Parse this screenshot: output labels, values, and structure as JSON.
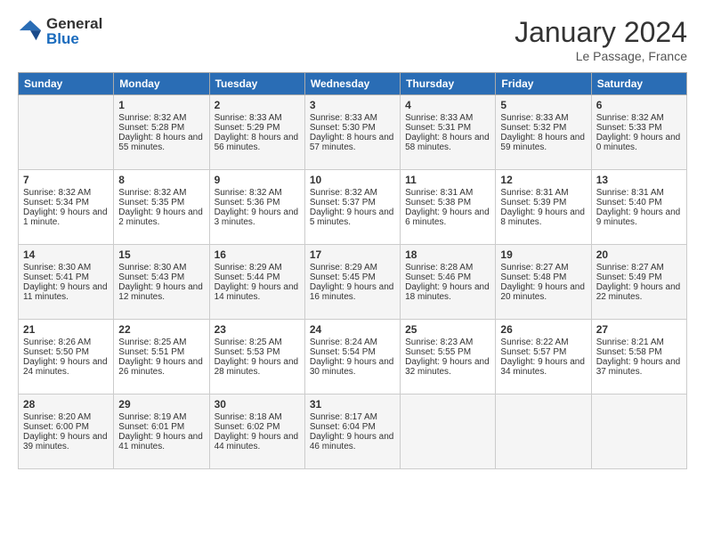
{
  "logo": {
    "general": "General",
    "blue": "Blue"
  },
  "title": "January 2024",
  "subtitle": "Le Passage, France",
  "days_header": [
    "Sunday",
    "Monday",
    "Tuesday",
    "Wednesday",
    "Thursday",
    "Friday",
    "Saturday"
  ],
  "weeks": [
    [
      {
        "day": "",
        "sunrise": "",
        "sunset": "",
        "daylight": ""
      },
      {
        "day": "1",
        "sunrise": "Sunrise: 8:32 AM",
        "sunset": "Sunset: 5:28 PM",
        "daylight": "Daylight: 8 hours and 55 minutes."
      },
      {
        "day": "2",
        "sunrise": "Sunrise: 8:33 AM",
        "sunset": "Sunset: 5:29 PM",
        "daylight": "Daylight: 8 hours and 56 minutes."
      },
      {
        "day": "3",
        "sunrise": "Sunrise: 8:33 AM",
        "sunset": "Sunset: 5:30 PM",
        "daylight": "Daylight: 8 hours and 57 minutes."
      },
      {
        "day": "4",
        "sunrise": "Sunrise: 8:33 AM",
        "sunset": "Sunset: 5:31 PM",
        "daylight": "Daylight: 8 hours and 58 minutes."
      },
      {
        "day": "5",
        "sunrise": "Sunrise: 8:33 AM",
        "sunset": "Sunset: 5:32 PM",
        "daylight": "Daylight: 8 hours and 59 minutes."
      },
      {
        "day": "6",
        "sunrise": "Sunrise: 8:32 AM",
        "sunset": "Sunset: 5:33 PM",
        "daylight": "Daylight: 9 hours and 0 minutes."
      }
    ],
    [
      {
        "day": "7",
        "sunrise": "Sunrise: 8:32 AM",
        "sunset": "Sunset: 5:34 PM",
        "daylight": "Daylight: 9 hours and 1 minute."
      },
      {
        "day": "8",
        "sunrise": "Sunrise: 8:32 AM",
        "sunset": "Sunset: 5:35 PM",
        "daylight": "Daylight: 9 hours and 2 minutes."
      },
      {
        "day": "9",
        "sunrise": "Sunrise: 8:32 AM",
        "sunset": "Sunset: 5:36 PM",
        "daylight": "Daylight: 9 hours and 3 minutes."
      },
      {
        "day": "10",
        "sunrise": "Sunrise: 8:32 AM",
        "sunset": "Sunset: 5:37 PM",
        "daylight": "Daylight: 9 hours and 5 minutes."
      },
      {
        "day": "11",
        "sunrise": "Sunrise: 8:31 AM",
        "sunset": "Sunset: 5:38 PM",
        "daylight": "Daylight: 9 hours and 6 minutes."
      },
      {
        "day": "12",
        "sunrise": "Sunrise: 8:31 AM",
        "sunset": "Sunset: 5:39 PM",
        "daylight": "Daylight: 9 hours and 8 minutes."
      },
      {
        "day": "13",
        "sunrise": "Sunrise: 8:31 AM",
        "sunset": "Sunset: 5:40 PM",
        "daylight": "Daylight: 9 hours and 9 minutes."
      }
    ],
    [
      {
        "day": "14",
        "sunrise": "Sunrise: 8:30 AM",
        "sunset": "Sunset: 5:41 PM",
        "daylight": "Daylight: 9 hours and 11 minutes."
      },
      {
        "day": "15",
        "sunrise": "Sunrise: 8:30 AM",
        "sunset": "Sunset: 5:43 PM",
        "daylight": "Daylight: 9 hours and 12 minutes."
      },
      {
        "day": "16",
        "sunrise": "Sunrise: 8:29 AM",
        "sunset": "Sunset: 5:44 PM",
        "daylight": "Daylight: 9 hours and 14 minutes."
      },
      {
        "day": "17",
        "sunrise": "Sunrise: 8:29 AM",
        "sunset": "Sunset: 5:45 PM",
        "daylight": "Daylight: 9 hours and 16 minutes."
      },
      {
        "day": "18",
        "sunrise": "Sunrise: 8:28 AM",
        "sunset": "Sunset: 5:46 PM",
        "daylight": "Daylight: 9 hours and 18 minutes."
      },
      {
        "day": "19",
        "sunrise": "Sunrise: 8:27 AM",
        "sunset": "Sunset: 5:48 PM",
        "daylight": "Daylight: 9 hours and 20 minutes."
      },
      {
        "day": "20",
        "sunrise": "Sunrise: 8:27 AM",
        "sunset": "Sunset: 5:49 PM",
        "daylight": "Daylight: 9 hours and 22 minutes."
      }
    ],
    [
      {
        "day": "21",
        "sunrise": "Sunrise: 8:26 AM",
        "sunset": "Sunset: 5:50 PM",
        "daylight": "Daylight: 9 hours and 24 minutes."
      },
      {
        "day": "22",
        "sunrise": "Sunrise: 8:25 AM",
        "sunset": "Sunset: 5:51 PM",
        "daylight": "Daylight: 9 hours and 26 minutes."
      },
      {
        "day": "23",
        "sunrise": "Sunrise: 8:25 AM",
        "sunset": "Sunset: 5:53 PM",
        "daylight": "Daylight: 9 hours and 28 minutes."
      },
      {
        "day": "24",
        "sunrise": "Sunrise: 8:24 AM",
        "sunset": "Sunset: 5:54 PM",
        "daylight": "Daylight: 9 hours and 30 minutes."
      },
      {
        "day": "25",
        "sunrise": "Sunrise: 8:23 AM",
        "sunset": "Sunset: 5:55 PM",
        "daylight": "Daylight: 9 hours and 32 minutes."
      },
      {
        "day": "26",
        "sunrise": "Sunrise: 8:22 AM",
        "sunset": "Sunset: 5:57 PM",
        "daylight": "Daylight: 9 hours and 34 minutes."
      },
      {
        "day": "27",
        "sunrise": "Sunrise: 8:21 AM",
        "sunset": "Sunset: 5:58 PM",
        "daylight": "Daylight: 9 hours and 37 minutes."
      }
    ],
    [
      {
        "day": "28",
        "sunrise": "Sunrise: 8:20 AM",
        "sunset": "Sunset: 6:00 PM",
        "daylight": "Daylight: 9 hours and 39 minutes."
      },
      {
        "day": "29",
        "sunrise": "Sunrise: 8:19 AM",
        "sunset": "Sunset: 6:01 PM",
        "daylight": "Daylight: 9 hours and 41 minutes."
      },
      {
        "day": "30",
        "sunrise": "Sunrise: 8:18 AM",
        "sunset": "Sunset: 6:02 PM",
        "daylight": "Daylight: 9 hours and 44 minutes."
      },
      {
        "day": "31",
        "sunrise": "Sunrise: 8:17 AM",
        "sunset": "Sunset: 6:04 PM",
        "daylight": "Daylight: 9 hours and 46 minutes."
      },
      {
        "day": "",
        "sunrise": "",
        "sunset": "",
        "daylight": ""
      },
      {
        "day": "",
        "sunrise": "",
        "sunset": "",
        "daylight": ""
      },
      {
        "day": "",
        "sunrise": "",
        "sunset": "",
        "daylight": ""
      }
    ]
  ]
}
